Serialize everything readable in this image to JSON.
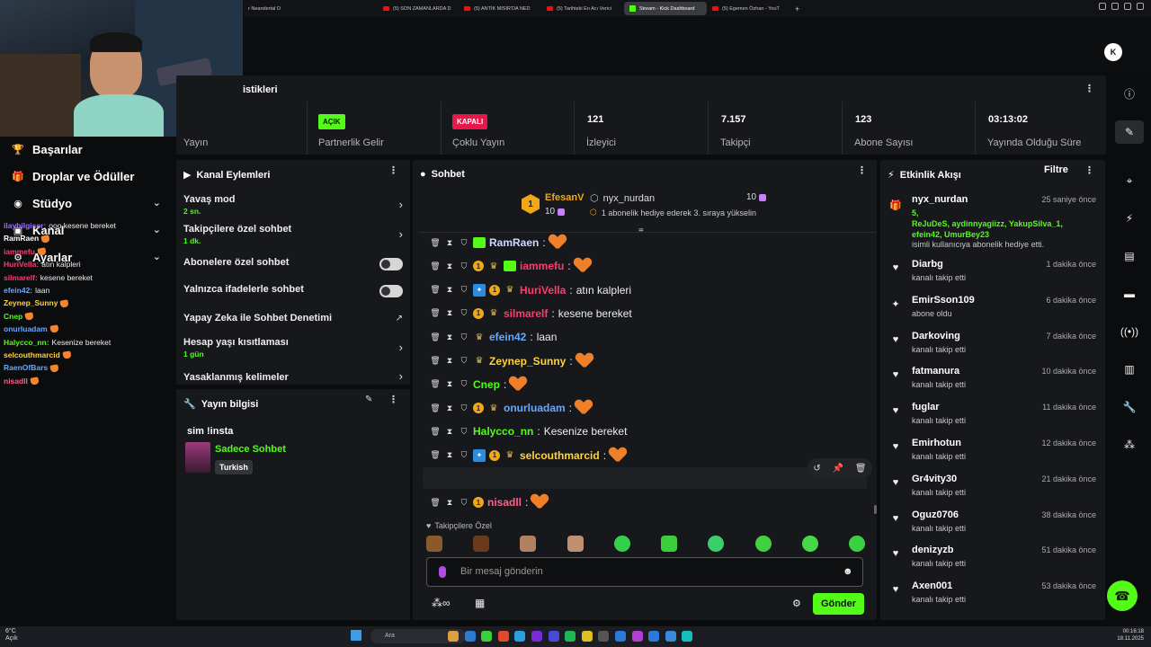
{
  "browser": {
    "tabs": [
      {
        "label": "r Neandertal O"
      },
      {
        "label": "(5) SON ZAMANLARDA D"
      },
      {
        "label": "(5) ANTİK MISIR'DA NED"
      },
      {
        "label": "(5) Tarihteki En Acı Verici"
      },
      {
        "label": "Stream - Kick Dashboard",
        "active": true
      },
      {
        "label": "(5) Egemen Özhan - YouT"
      }
    ],
    "new_tab": "+"
  },
  "sidebar": {
    "items": [
      {
        "label": "Başarılar",
        "icon": "trophy-icon"
      },
      {
        "label": "Droplar ve Ödüller",
        "icon": "gift-icon"
      },
      {
        "label": "Stüdyo",
        "icon": "studio-icon"
      },
      {
        "label": "Kanal",
        "icon": "channel-icon"
      },
      {
        "label": "Ayarlar",
        "icon": "settings-icon"
      }
    ]
  },
  "overlay_chat": [
    {
      "user": "ilaybilgiser",
      "text": "ooo kesene bereket",
      "color": "#a070ff"
    },
    {
      "user": "RamRaen",
      "text": "",
      "color": "#ffffff"
    },
    {
      "user": "iammefu",
      "text": "",
      "color": "#ff3b6e"
    },
    {
      "user": "HuriVella",
      "text": "atın kalpleri",
      "color": "#ff3b6e"
    },
    {
      "user": "silmarelf",
      "text": "kesene bereket",
      "color": "#ff3b6e"
    },
    {
      "user": "efein42",
      "text": "laan",
      "color": "#66a8ff"
    },
    {
      "user": "Zeynep_Sunny",
      "text": "",
      "color": "#ffd23c"
    },
    {
      "user": "Cnep",
      "text": "",
      "color": "#53fc18"
    },
    {
      "user": "onurluadam",
      "text": "",
      "color": "#66a8ff"
    },
    {
      "user": "Halycco_nn",
      "text": "Kesenize bereket",
      "color": "#53fc18"
    },
    {
      "user": "selcouthmarcid",
      "text": "",
      "color": "#ffd23c"
    },
    {
      "user": "RaenOfBars",
      "text": "",
      "color": "#66a8ff"
    },
    {
      "user": "nisadll",
      "text": "",
      "color": "#ff5f8a"
    }
  ],
  "stats": {
    "title": "istikleri",
    "cells": [
      {
        "value": "",
        "label": "Yayın"
      },
      {
        "value": "AÇIK",
        "label": "Partnerlik Gelir"
      },
      {
        "value": "KAPALI",
        "label": "Çoklu Yayın"
      },
      {
        "value": "121",
        "label": "İzleyici"
      },
      {
        "value": "7.157",
        "label": "Takipçi"
      },
      {
        "value": "123",
        "label": "Abone Sayısı"
      },
      {
        "value": "03:13:02",
        "label": "Yayında Olduğu Süre"
      }
    ]
  },
  "channel_actions": {
    "title": "Kanal Eylemleri",
    "rows": [
      {
        "label": "Yavaş mod",
        "sub": "2 sn."
      },
      {
        "label": "Takipçilere özel sohbet",
        "sub": "1 dk."
      },
      {
        "label": "Abonelere özel sohbet",
        "sub": ""
      },
      {
        "label": "Yalnızca ifadelerle sohbet",
        "sub": ""
      },
      {
        "label": "Yapay Zeka ile Sohbet Denetimi",
        "sub": ""
      },
      {
        "label": "Hesap yaşı kısıtlaması",
        "sub": "1 gün"
      },
      {
        "label": "Yasaklanmış kelimeler",
        "sub": ""
      }
    ]
  },
  "stream_info": {
    "title": "Yayın bilgisi",
    "stream_title": "sim !insta",
    "category": "Sadece Sohbet",
    "language": "Turkish"
  },
  "chat": {
    "title": "Sohbet",
    "pinned": {
      "user": "EfesanV",
      "count": "10",
      "target": "nyx_nurdan",
      "target_count": "10",
      "message": "1 abonelik hediye ederek 3. sıraya yükselin"
    },
    "messages": [
      {
        "user": "RamRaen",
        "text": "",
        "color": "#cfd9ff"
      },
      {
        "user": "iammefu",
        "text": "",
        "color": "#ff3b6e"
      },
      {
        "user": "HuriVella",
        "text": "atın kalpleri",
        "color": "#ff3b6e"
      },
      {
        "user": "silmarelf",
        "text": "kesene bereket",
        "color": "#ff3b6e"
      },
      {
        "user": "efein42",
        "text": "laan",
        "color": "#66a8ff"
      },
      {
        "user": "Zeynep_Sunny",
        "text": "",
        "color": "#ffd23c"
      },
      {
        "user": "Cnep",
        "text": "",
        "color": "#53fc18"
      },
      {
        "user": "onurluadam",
        "text": "",
        "color": "#66a8ff"
      },
      {
        "user": "Halycco_nn",
        "text": "Kesenize bereket",
        "color": "#53fc18"
      },
      {
        "user": "selcouthmarcid",
        "text": "",
        "color": "#ffd23c"
      },
      {
        "user": "RaenOfBars",
        "text": "",
        "color": "#66a8ff"
      },
      {
        "user": "nisadll",
        "text": "",
        "color": "#ff5f8a"
      }
    ],
    "followers_only_label": "Takipçilere Özel",
    "input_placeholder": "Bir mesaj gönderin",
    "send_label": "Gönder"
  },
  "activity": {
    "title": "Etkinlik Akışı",
    "filter_label": "Filtre",
    "events": [
      {
        "name": "nyx_nurdan",
        "time": "25 saniye önce",
        "desc": "isimli kullanıcıya abonelik hediye etti.",
        "gift_count": "5,",
        "gift_names_1": "ReJuDeS, aydinnyagiizz, YakupSilva_1,",
        "gift_names_2": "efein42, UmurBey23",
        "icon": "gift-icon"
      },
      {
        "name": "Diarbg",
        "time": "1 dakika önce",
        "desc": "kanalı takip etti",
        "icon": "heart-icon"
      },
      {
        "name": "EmirSson109",
        "time": "6 dakika önce",
        "desc": "abone oldu",
        "icon": "star-icon"
      },
      {
        "name": "Darkoving",
        "time": "7 dakika önce",
        "desc": "kanalı takip etti",
        "icon": "heart-icon"
      },
      {
        "name": "fatmanura",
        "time": "10 dakika önce",
        "desc": "kanalı takip etti",
        "icon": "heart-icon"
      },
      {
        "name": "fuglar",
        "time": "11 dakika önce",
        "desc": "kanalı takip etti",
        "icon": "heart-icon"
      },
      {
        "name": "Emirhotun",
        "time": "12 dakika önce",
        "desc": "kanalı takip etti",
        "icon": "heart-icon"
      },
      {
        "name": "Gr4vity30",
        "time": "21 dakika önce",
        "desc": "kanalı takip etti",
        "icon": "heart-icon"
      },
      {
        "name": "Oguz0706",
        "time": "38 dakika önce",
        "desc": "kanalı takip etti",
        "icon": "heart-icon"
      },
      {
        "name": "denizyzb",
        "time": "51 dakika önce",
        "desc": "kanalı takip etti",
        "icon": "heart-icon"
      },
      {
        "name": "Axen001",
        "time": "53 dakika önce",
        "desc": "kanalı takip etti",
        "icon": "heart-icon"
      }
    ]
  },
  "taskbar": {
    "weather_temp": "6°C",
    "weather_text": "Açık",
    "search_placeholder": "Ara",
    "time": "00:16:18",
    "date": "18.11.2025"
  },
  "colors": {
    "accent": "#53fc18",
    "danger": "#e8174a",
    "bg": "#0b0c0e",
    "panel": "#17181b"
  }
}
